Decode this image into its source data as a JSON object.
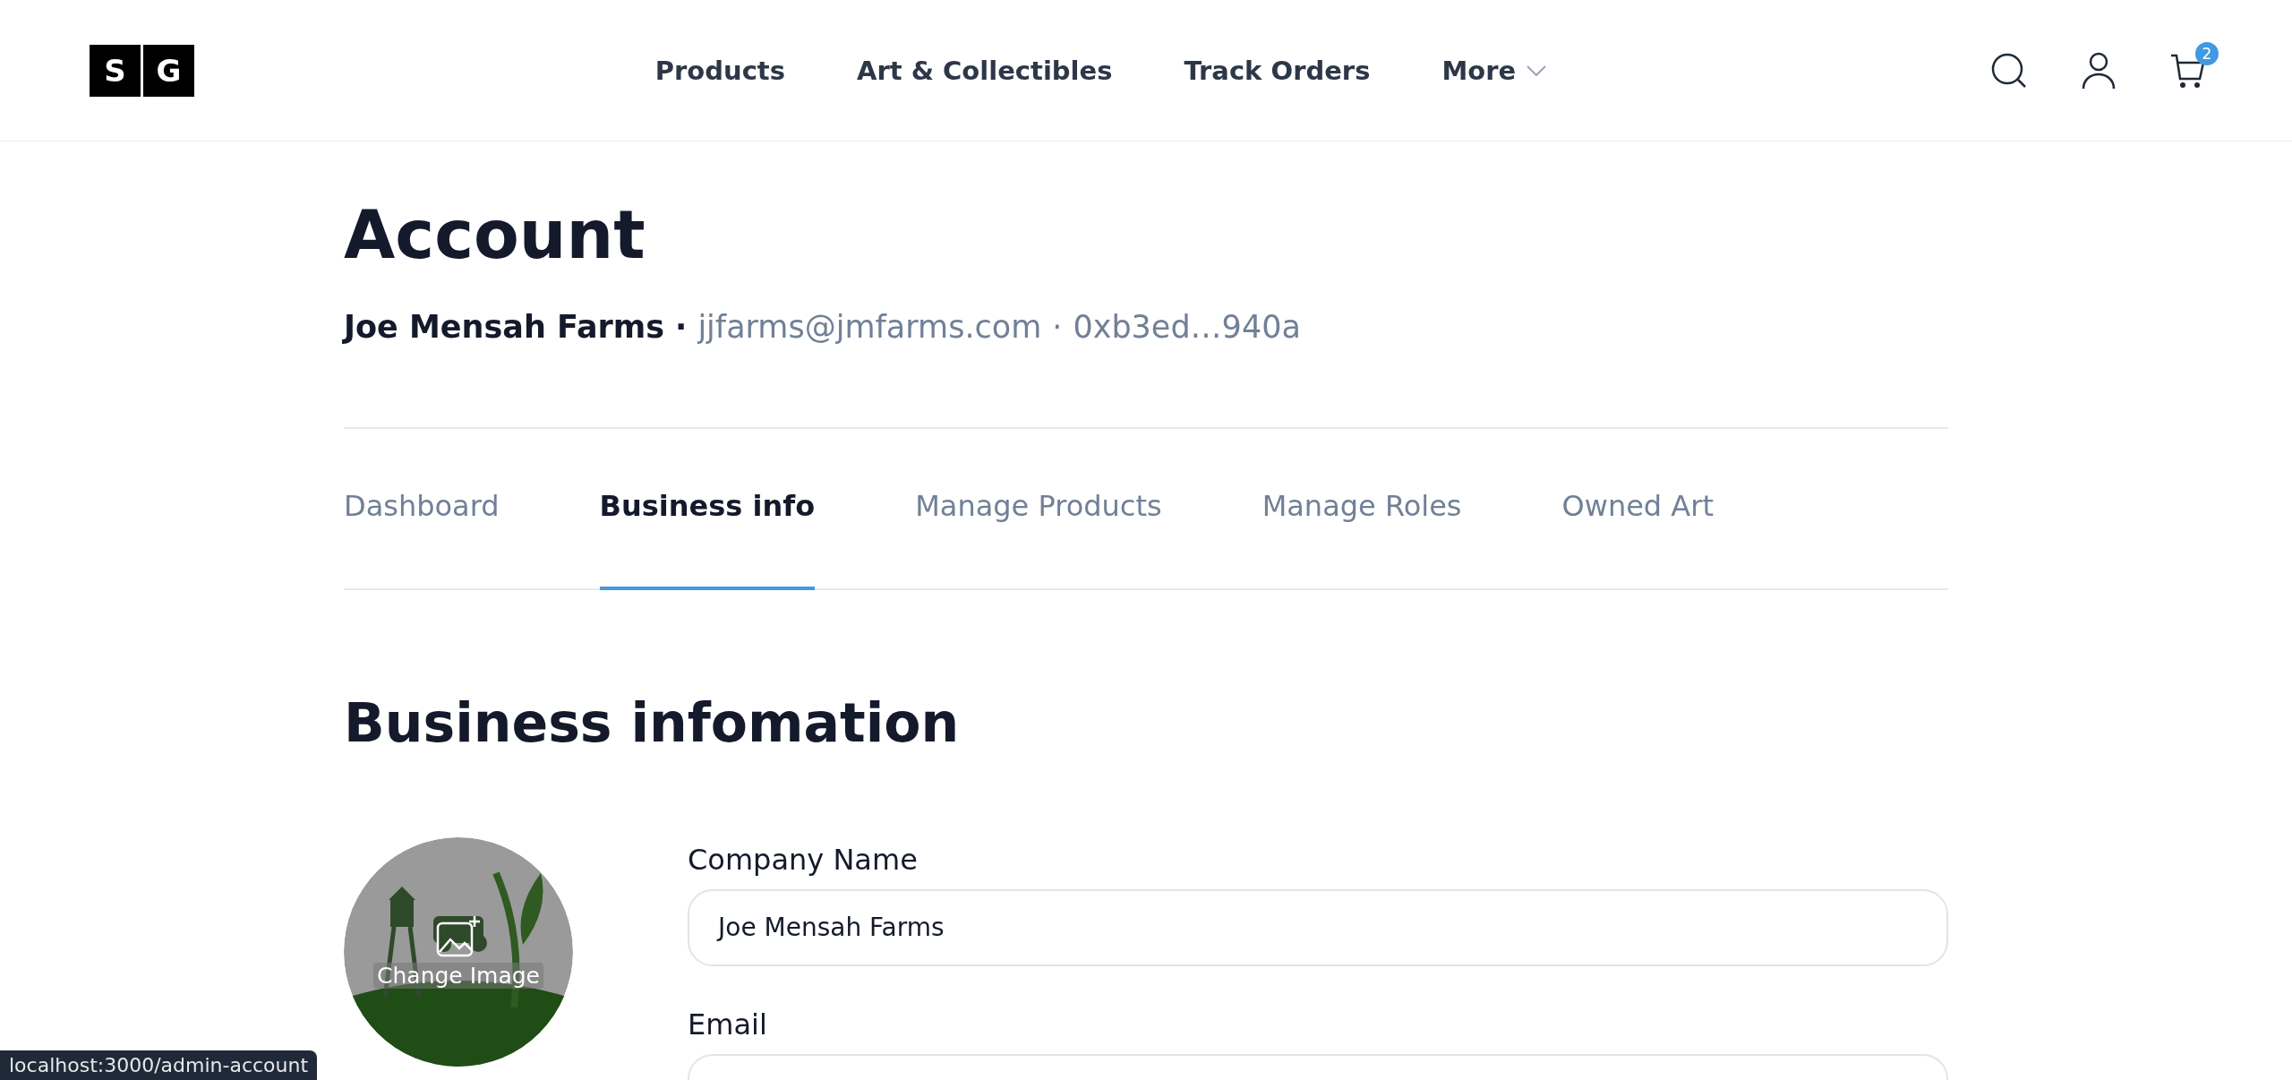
{
  "logo": {
    "letters": [
      "S",
      "G"
    ]
  },
  "nav": [
    {
      "label": "Products",
      "dropdown": false
    },
    {
      "label": "Art & Collectibles",
      "dropdown": false
    },
    {
      "label": "Track Orders",
      "dropdown": false
    },
    {
      "label": "More",
      "dropdown": true
    }
  ],
  "cart": {
    "count": "2"
  },
  "account": {
    "title": "Account",
    "name": "Joe Mensah Farms",
    "separator": "·",
    "email": "jjfarms@jmfarms.com",
    "wallet": "0xb3ed…940a"
  },
  "tabs": [
    {
      "label": "Dashboard",
      "selected": false
    },
    {
      "label": "Business info",
      "selected": true
    },
    {
      "label": "Manage Products",
      "selected": false
    },
    {
      "label": "Manage Roles",
      "selected": false
    },
    {
      "label": "Owned Art",
      "selected": false
    }
  ],
  "section": {
    "title": "Business infomation",
    "change_image": "Change Image",
    "fields": [
      {
        "label": "Company Name",
        "value": "Joe Mensah Farms"
      },
      {
        "label": "Email"
      }
    ]
  },
  "status_bar": "localhost:3000/admin-account"
}
